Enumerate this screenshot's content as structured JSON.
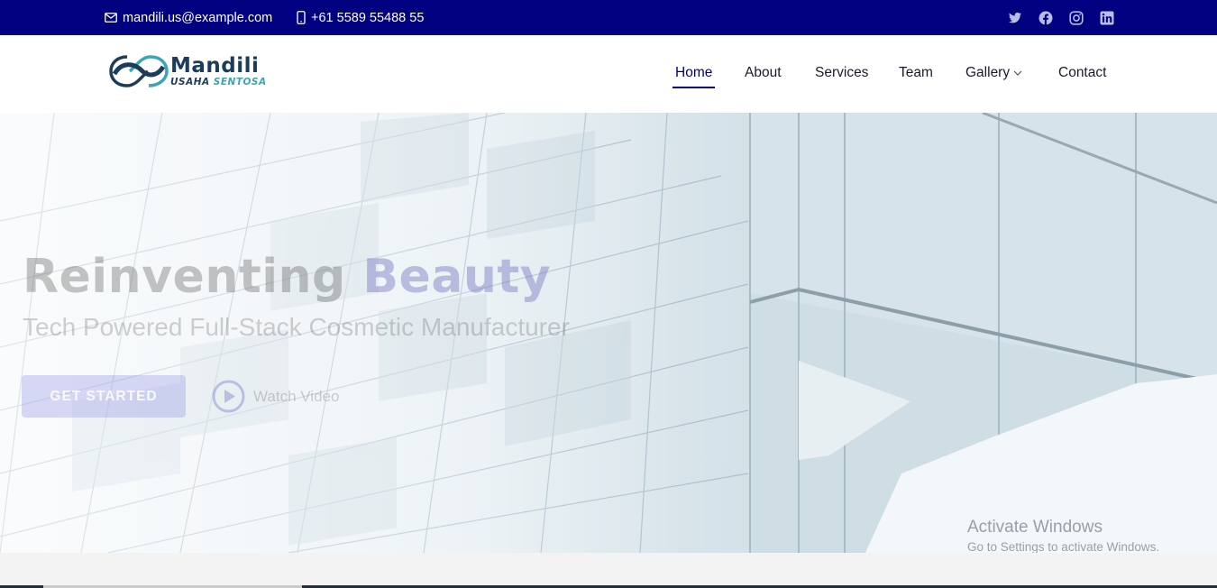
{
  "topbar": {
    "email": "mandili.us@example.com",
    "phone": "+61 5589 55488 55",
    "socials": [
      "twitter-icon",
      "facebook-icon",
      "instagram-icon",
      "linkedin-icon"
    ]
  },
  "header": {
    "logo": {
      "name": "Mandili",
      "tagline_part1": "USAHA",
      "tagline_part2": "SENTOSA"
    },
    "nav": {
      "home": "Home",
      "about": "About",
      "services": "Services",
      "team": "Team",
      "gallery": "Gallery",
      "contact": "Contact"
    },
    "active_item": "Home"
  },
  "hero": {
    "title_part1": "Reinventing ",
    "title_part2": "Beauty",
    "subtitle": "Tech Powered Full-Stack Cosmetic Manufacturer",
    "cta_label": "GET STARTED",
    "video_label": "Watch Video"
  },
  "watermark": {
    "title": "Activate Windows",
    "subtitle": "Go to Settings to activate Windows."
  },
  "colors": {
    "topbar": "#000080",
    "accent": "#000080",
    "logo_dark": "#1c3d5a",
    "logo_teal": "#3aa4b8"
  }
}
